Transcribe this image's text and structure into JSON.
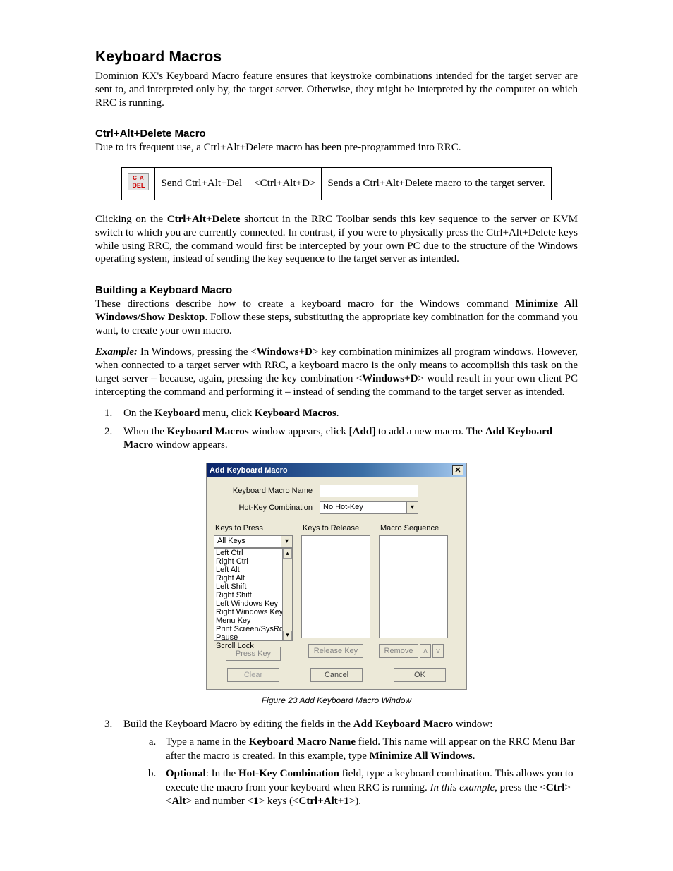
{
  "h1": "Keyboard Macros",
  "intro": "Dominion KX's Keyboard Macro feature ensures that keystroke combinations intended for the target server are sent to, and interpreted only by, the target server. Otherwise, they might be interpreted by the computer on which RRC is running.",
  "h2a": "Ctrl+Alt+Delete Macro",
  "p2": "Due to its frequent use, a Ctrl+Alt+Delete macro has been pre-programmed into RRC.",
  "tbl": {
    "c1": "Send Ctrl+Alt+Del",
    "c2": "<Ctrl+Alt+D>",
    "c3": "Sends a Ctrl+Alt+Delete macro to the target server."
  },
  "p3a": "Clicking on the ",
  "p3b": "Ctrl+Alt+Delete",
  "p3c": " shortcut in the RRC Toolbar sends this key sequence to the server or KVM switch to which you are currently connected. In contrast, if you were to physically press the Ctrl+Alt+Delete keys while using RRC, the command would first be intercepted by your own PC due to the structure of the Windows operating system, instead of sending the key sequence to the target server as intended.",
  "h2b": "Building a Keyboard Macro",
  "p4a": "These directions describe how to create a keyboard macro for the Windows command ",
  "p4b": "Minimize All Windows/Show Desktop",
  "p4c": ". Follow these steps, substituting the appropriate key combination for the command you want, to create your own macro.",
  "ex_label": "Example:",
  "ex_a": " In Windows, pressing the <",
  "ex_b": "Windows+D",
  "ex_c": "> key combination minimizes all program windows. However, when connected to a target server with RRC, a keyboard macro is the only means to accomplish this task on the target server – because, again, pressing the key combination <",
  "ex_d": "Windows+D",
  "ex_e": "> would result in your own client PC intercepting the command and performing it – instead of sending the command to the target server as intended.",
  "li1a": "On the ",
  "li1b": "Keyboard",
  "li1c": " menu, click ",
  "li1d": "Keyboard Macros",
  "li2a": "When the ",
  "li2b": "Keyboard Macros",
  "li2c": " window appears, click [",
  "li2d": "Add",
  "li2e": "] to add a new macro. The ",
  "li2f": "Add Keyboard Macro",
  "li2g": " window appears.",
  "dlg": {
    "title": "Add Keyboard Macro",
    "lab_name": "Keyboard Macro Name",
    "lab_hot": "Hot-Key Combination",
    "hot_val": "No Hot-Key",
    "keys_to_press": "Keys to Press",
    "all_keys": "All Keys",
    "keys_to_release": "Keys to Release",
    "macro_seq": "Macro Sequence",
    "list": [
      "Left Ctrl",
      "Right Ctrl",
      "Left Alt",
      "Right Alt",
      "Left Shift",
      "Right Shift",
      "Left Windows Key",
      "Right Windows Key",
      "Menu Key",
      "Print Screen/SysRq",
      "Pause",
      "Scroll Lock"
    ],
    "btn_press": "Press Key",
    "btn_release": "Release Key",
    "btn_remove": "Remove",
    "btn_up": "ʌ",
    "btn_dn": "v",
    "btn_clear": "Clear",
    "btn_cancel": "Cancel",
    "btn_ok": "OK"
  },
  "figcap": "Figure 23 Add Keyboard Macro Window",
  "li3a": "Build the Keyboard Macro by editing the fields in the ",
  "li3b": "Add Keyboard Macro",
  "li3c": " window:",
  "sa_a": "Type a name in the ",
  "sa_b": "Keyboard Macro Name",
  "sa_c": " field. This name will appear on the RRC Menu Bar after the macro is created. In this example, type ",
  "sa_d": "Minimize All Windows",
  "sb_a": "Optional",
  "sb_b": ": In the ",
  "sb_c": "Hot-Key Combination",
  "sb_d": " field, type a keyboard combination. This allows you to execute the macro from your keyboard when RRC is running. ",
  "sb_e": "In this example",
  "sb_f": ", press the <",
  "sb_g": "Ctrl",
  "sb_h": "> <",
  "sb_i": "Alt",
  "sb_j": "> and number <",
  "sb_k": "1",
  "sb_l": "> keys (<",
  "sb_m": "Ctrl+Alt+1",
  "sb_n": ">)."
}
